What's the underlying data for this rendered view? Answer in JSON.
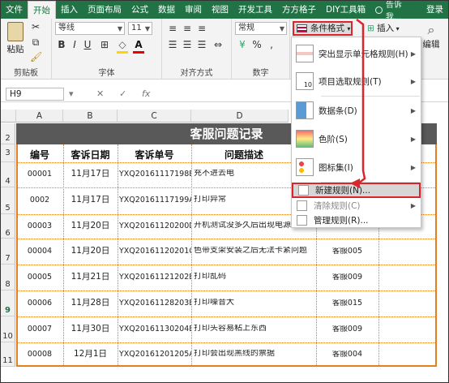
{
  "ribbon": {
    "tabs": [
      "文件",
      "开始",
      "插入",
      "页面布局",
      "公式",
      "数据",
      "审阅",
      "视图",
      "开发工具",
      "方方格子",
      "DIY工具箱"
    ],
    "active_tab": "开始",
    "tell_me": "告诉我...",
    "login": "登录",
    "font_name": "等线",
    "font_size": "11",
    "number_format": "常规",
    "paste_label": "粘贴",
    "insert_label": "插入",
    "edit_label": "编辑",
    "cond_format_label": "条件格式",
    "groups": {
      "clipboard": "剪贴板",
      "font": "字体",
      "alignment": "对齐方式",
      "number": "数字"
    }
  },
  "formula_bar": {
    "name_box": "H9",
    "fx": "fx"
  },
  "columns": [
    "A",
    "B",
    "C",
    "D"
  ],
  "rows": [
    "2",
    "3",
    "4",
    "5",
    "6",
    "7",
    "8",
    "9",
    "10",
    "11"
  ],
  "sheet": {
    "title": "客服问题记录",
    "headers": [
      "编号",
      "客诉日期",
      "客诉单号",
      "问题描述"
    ],
    "data": [
      {
        "id": "00001",
        "date": "11月17日",
        "no": "YXQ20161117198BB",
        "desc": "充不进去电",
        "extra": ""
      },
      {
        "id": "0002",
        "date": "11月17日",
        "no": "YXQ20161117199AC",
        "desc": "打印异常",
        "extra": ""
      },
      {
        "id": "00003",
        "date": "11月20日",
        "no": "YXQ20161120200DH",
        "desc": "开机测试没多久后出现电源灯",
        "extra": ""
      },
      {
        "id": "00004",
        "date": "11月20日",
        "no": "YXQ20161120201CS",
        "desc": "色带支架安装之后无法卡紧问题",
        "extra": "客服005"
      },
      {
        "id": "00005",
        "date": "11月21日",
        "no": "YXQ20161121202BR",
        "desc": "打印乱码",
        "extra": "客服009"
      },
      {
        "id": "00006",
        "date": "11月28日",
        "no": "YXQ20161128203BF",
        "desc": "打印噪音大",
        "extra": "客服015"
      },
      {
        "id": "00007",
        "date": "11月30日",
        "no": "YXQ20161130204BM",
        "desc": "打印头容易粘上东西",
        "extra": "客服009"
      },
      {
        "id": "00008",
        "date": "12月1日",
        "no": "YXQ20161201205AC",
        "desc": "打印会出现黑线的票据",
        "extra": "客服004"
      }
    ]
  },
  "menu": {
    "items": [
      {
        "label": "突出显示单元格规则(H)",
        "icon": "highlight-cells-icon",
        "submenu": true
      },
      {
        "label": "项目选取规则(T)",
        "icon": "top-bottom-icon",
        "submenu": true
      },
      {
        "label": "数据条(D)",
        "icon": "data-bars-icon",
        "submenu": true
      },
      {
        "label": "色阶(S)",
        "icon": "color-scales-icon",
        "submenu": true
      },
      {
        "label": "图标集(I)",
        "icon": "icon-sets-icon",
        "submenu": true
      }
    ],
    "new_rule": "新建规则(N)...",
    "clear_rules": "清除规则(C)",
    "manage_rules": "管理规则(R)..."
  },
  "colors": {
    "ribbon_green": "#217346",
    "accent_red": "#d9262c",
    "table_border": "#e67e22",
    "title_bg": "#595959"
  }
}
